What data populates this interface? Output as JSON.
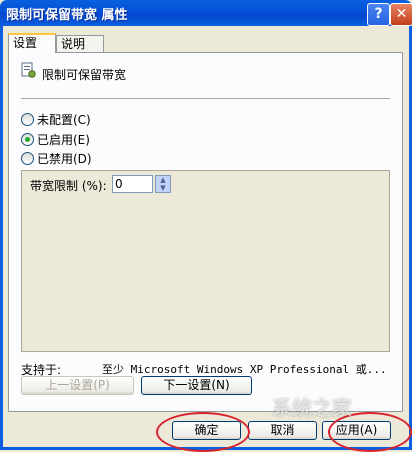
{
  "window": {
    "title": "限制可保留带宽 属性",
    "help_label": "?",
    "close_label": "✕"
  },
  "tabs": [
    {
      "label": "设置"
    },
    {
      "label": "说明"
    }
  ],
  "policy": {
    "title": "限制可保留带宽"
  },
  "radios": [
    {
      "label": "未配置(C)",
      "checked": false
    },
    {
      "label": "已启用(E)",
      "checked": true
    },
    {
      "label": "已禁用(D)",
      "checked": false
    }
  ],
  "option": {
    "label": "带宽限制 (%):",
    "value": "0"
  },
  "supported": {
    "label": "支持于:",
    "value": "至少 Microsoft Windows XP Professional 或..."
  },
  "nav": {
    "prev_label": "上一设置(P)",
    "next_label": "下一设置(N)"
  },
  "footer": {
    "ok_label": "确定",
    "cancel_label": "取消",
    "apply_label": "应用(A)"
  },
  "watermark": "系统之家",
  "colors": {
    "title_bar": "#0a5fe0",
    "annotation": "#d9232d",
    "selected_radio": "#22a82a"
  }
}
